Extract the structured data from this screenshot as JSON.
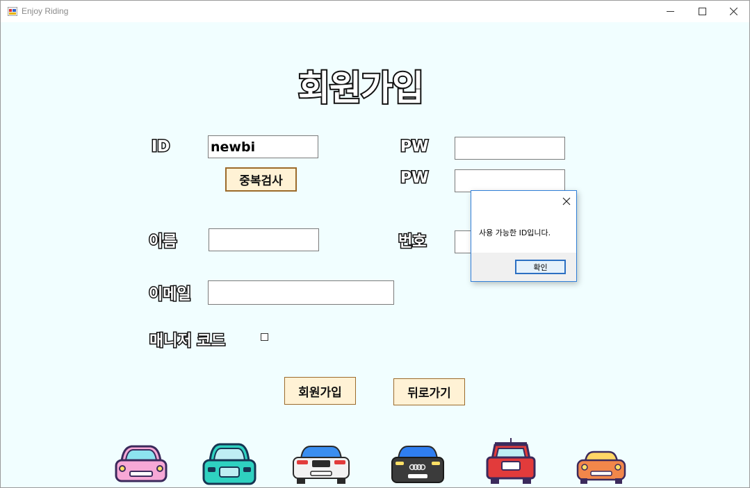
{
  "window": {
    "title": "Enjoy Riding"
  },
  "form": {
    "heading": "회원가입",
    "id_label": "ID",
    "id_value": "newbi",
    "check_button": "중복검사",
    "pw_label": "PW",
    "pw_value": "",
    "pw_confirm_label": "PW",
    "pw_confirm_value": "",
    "name_label": "이름",
    "name_value": "",
    "phone_label": "번호",
    "phone_value": "",
    "email_label": "이메일",
    "email_value": "",
    "manager_label": "매니저 코드",
    "manager_checked": false,
    "signup_button": "회원가입",
    "back_button": "뒤로가기"
  },
  "dialog": {
    "message": "사용 가능한 ID입니다.",
    "ok_button": "확인"
  },
  "cars": [
    "pink-car-icon",
    "teal-car-icon",
    "blue-white-car-icon",
    "dark-car-icon",
    "red-jeep-icon",
    "orange-car-icon"
  ]
}
